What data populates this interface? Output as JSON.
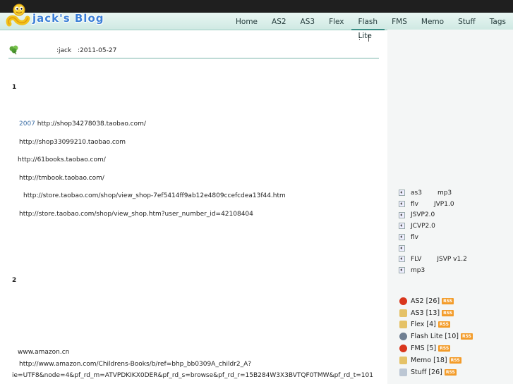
{
  "header": {
    "logo_text": "jack's Blog",
    "nav": [
      "Home",
      "AS2",
      "AS3",
      "Flex",
      "Flash Lite",
      "FMS",
      "Memo",
      "Stuff",
      "Tags"
    ]
  },
  "post": {
    "author": ":jack",
    "date": ":2011-05-27",
    "share_colon": ":",
    "share_bar": "|",
    "heading1": "1",
    "year": "2007",
    "links1": [
      "http://shop34278038.taobao.com/",
      "http://shop33099210.taobao.com",
      "http://61books.taobao.com/",
      "http://tmbook.taobao.com/",
      "http://store.taobao.com/shop/view_shop-7ef5414ff9ab12e4809ccefcdea13f44.htm",
      "http://store.taobao.com/shop/view_shop.htm?user_number_id=42108404"
    ],
    "heading2": "2",
    "amazon": "www.amazon.cn",
    "amazon_link1": "http://www.amazon.com/Childrens-Books/b/ref=bhp_bb0309A_childr2_A?",
    "amazon_link2": "ie=UTF8&node=4&pf_rd_m=ATVPDKIKX0DER&pf_rd_s=browse&pf_rd_r=15B284W3X3BVTQF0TMW&pf_rd_t=101"
  },
  "sidebar": {
    "recent": [
      {
        "a": "as3",
        "b": "mp3"
      },
      {
        "a": "flv",
        "b": "JVP1.0"
      },
      {
        "a": "JSVP2.0",
        "b": ""
      },
      {
        "a": "JCVP2.0",
        "b": ""
      },
      {
        "a": "flv",
        "b": ""
      },
      {
        "a": "",
        "b": ""
      },
      {
        "a": "FLV",
        "b": "JSVP v1.2"
      },
      {
        "a": "mp3",
        "b": ""
      }
    ],
    "categories": [
      {
        "label": "AS2 [26]",
        "icon": "flash-icon",
        "color": "#d9361c"
      },
      {
        "label": "AS3 [13]",
        "icon": "folder-doc-icon",
        "color": "#e5c267"
      },
      {
        "label": "Flex [4]",
        "icon": "folder-doc-icon",
        "color": "#e5c267"
      },
      {
        "label": "Flash Lite [10]",
        "icon": "flashlite-icon",
        "color": "#6f7f92"
      },
      {
        "label": "FMS [5]",
        "icon": "flash-icon",
        "color": "#d9361c"
      },
      {
        "label": "Memo [18]",
        "icon": "memo-icon",
        "color": "#e5c267"
      },
      {
        "label": "Stuff [26]",
        "icon": "doc-icon",
        "color": "#bcc7d4"
      }
    ],
    "rss_label": "RSS"
  }
}
